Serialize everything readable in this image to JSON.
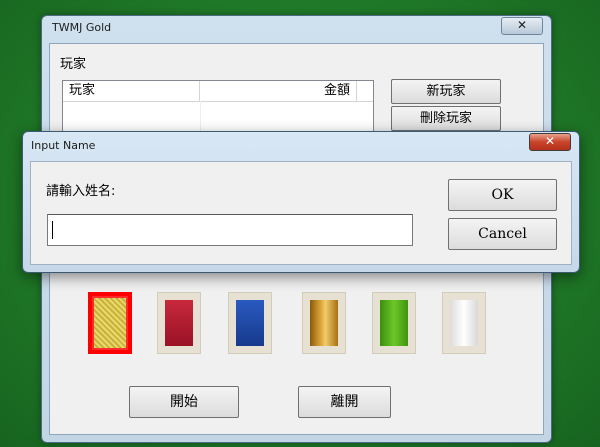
{
  "main_window": {
    "title": "TWMJ Gold",
    "close_symbol": "✕",
    "players_group_label": "玩家",
    "players_table": {
      "columns": [
        "玩家",
        "金額"
      ],
      "rows": []
    },
    "new_player_button": "新玩家",
    "delete_player_button": "刪除玩家",
    "tile_backs": [
      {
        "name": "yellow",
        "color": "#d8c24a",
        "selected": true
      },
      {
        "name": "red",
        "color": "#b01a2e",
        "selected": false
      },
      {
        "name": "blue",
        "color": "#1d48a8",
        "selected": false
      },
      {
        "name": "gold",
        "color": "#c08418",
        "selected": false
      },
      {
        "name": "green",
        "color": "#4fa61a",
        "selected": false
      },
      {
        "name": "white",
        "color": "#f2f2f2",
        "selected": false
      }
    ],
    "start_button": "開始",
    "exit_button": "離開"
  },
  "dialog": {
    "title": "Input Name",
    "close_symbol": "✕",
    "prompt": "請輸入姓名:",
    "name_input_value": "",
    "ok_button": "OK",
    "cancel_button": "Cancel"
  }
}
